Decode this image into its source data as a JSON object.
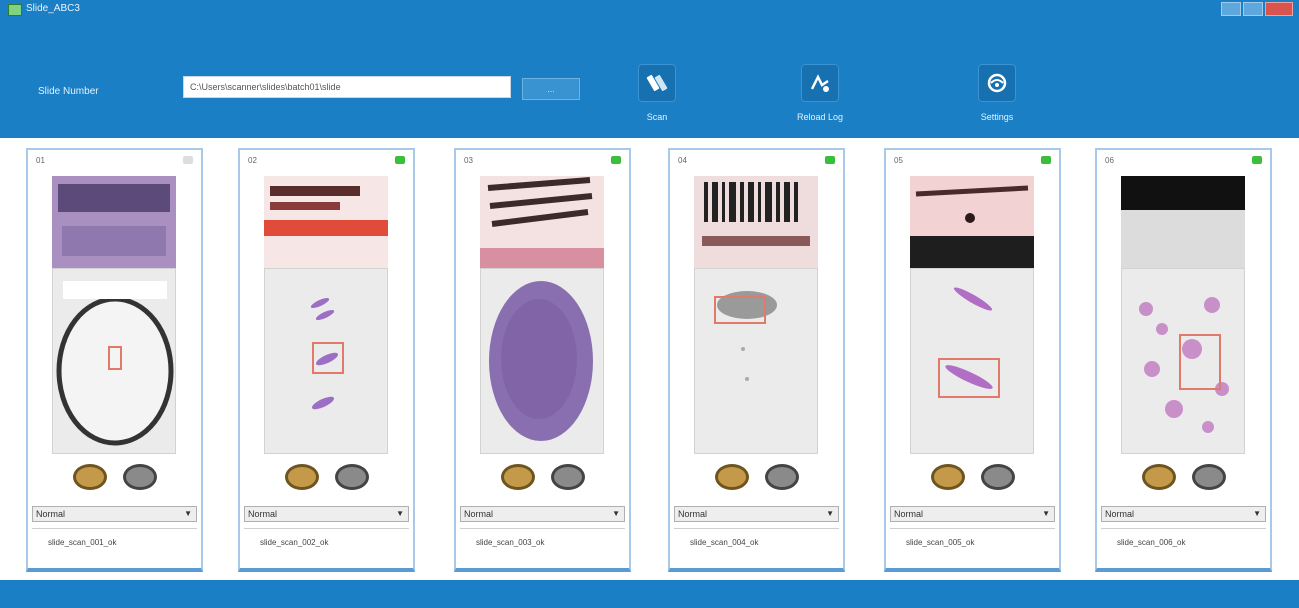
{
  "window": {
    "title": "Slide_ABC3"
  },
  "header": {
    "slide_label": "Slide Number",
    "path_value": "C:\\Users\\scanner\\slides\\batch01\\slide",
    "browse_label": "...",
    "tools": [
      {
        "label": "Scan",
        "icon": "slide-scan-icon"
      },
      {
        "label": "Reload Log",
        "icon": "reload-log-icon"
      },
      {
        "label": "Settings",
        "icon": "settings-icon"
      }
    ]
  },
  "cards": [
    {
      "id": "01",
      "status": "off",
      "dropdown": "Normal",
      "text": "slide_scan_001_ok"
    },
    {
      "id": "02",
      "status": "on",
      "dropdown": "Normal",
      "text": "slide_scan_002_ok"
    },
    {
      "id": "03",
      "status": "on",
      "dropdown": "Normal",
      "text": "slide_scan_003_ok"
    },
    {
      "id": "04",
      "status": "on",
      "dropdown": "Normal",
      "text": "slide_scan_004_ok"
    },
    {
      "id": "05",
      "status": "on",
      "dropdown": "Normal",
      "text": "slide_scan_005_ok"
    },
    {
      "id": "06",
      "status": "on",
      "dropdown": "Normal",
      "text": "slide_scan_006_ok"
    }
  ],
  "colors": {
    "primary": "#1a7fc4",
    "card_border": "#a9c9ea",
    "status_on": "#3bbf3b",
    "accept": "#c49a4a",
    "reject": "#8a8a8a"
  }
}
